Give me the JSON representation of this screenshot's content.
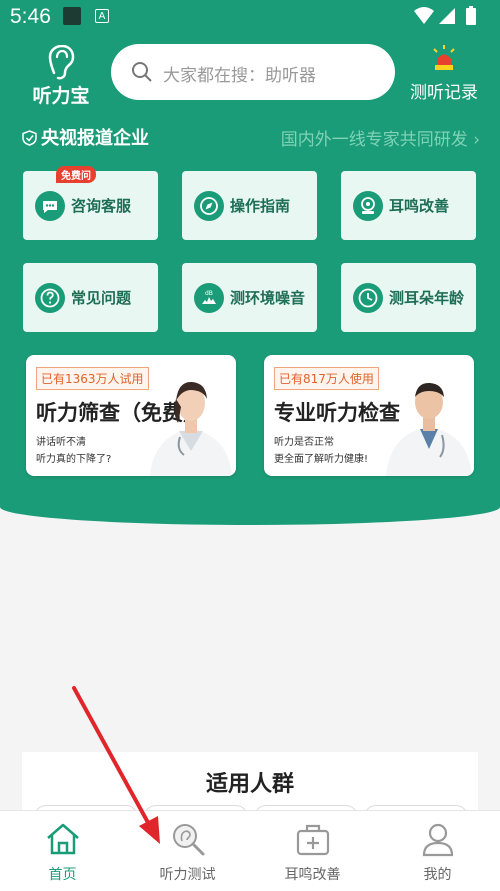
{
  "status": {
    "time": "5:46"
  },
  "header": {
    "logo_text": "听力宝",
    "search_placeholder": "大家都在搜：助听器",
    "record_label": "测听记录"
  },
  "banner": {
    "left": "央视报道企业",
    "right": "国内外一线专家共同研发 ›"
  },
  "tiles": [
    {
      "label": "咨询客服",
      "badge": "免费问",
      "icon": "chat-icon"
    },
    {
      "label": "操作指南",
      "icon": "compass-icon"
    },
    {
      "label": "耳鸣改善",
      "icon": "ear-improve-icon"
    },
    {
      "label": "常见问题",
      "icon": "question-icon"
    },
    {
      "label": "测环境噪音",
      "icon": "decibel-icon"
    },
    {
      "label": "测耳朵年龄",
      "icon": "clock-icon"
    }
  ],
  "cards": [
    {
      "tag": "已有1363万人试用",
      "title": "听力筛查（免费）",
      "sub1": "讲话听不清",
      "sub2": "听力真的下降了?"
    },
    {
      "tag": "已有817万人使用",
      "title": "专业听力检查",
      "sub1": "听力是否正常",
      "sub2": "更全面了解听力健康!"
    }
  ],
  "section": {
    "title": "适用人群"
  },
  "tabs": [
    {
      "label": "首页",
      "icon": "home-icon",
      "active": true
    },
    {
      "label": "听力测试",
      "icon": "hearing-test-icon",
      "active": false
    },
    {
      "label": "耳鸣改善",
      "icon": "medkit-icon",
      "active": false
    },
    {
      "label": "我的",
      "icon": "user-icon",
      "active": false
    }
  ],
  "colors": {
    "brand": "#1b9c78",
    "tile_bg": "#e9f7f2",
    "badge": "#e8402e",
    "arrow": "#e0262b"
  }
}
